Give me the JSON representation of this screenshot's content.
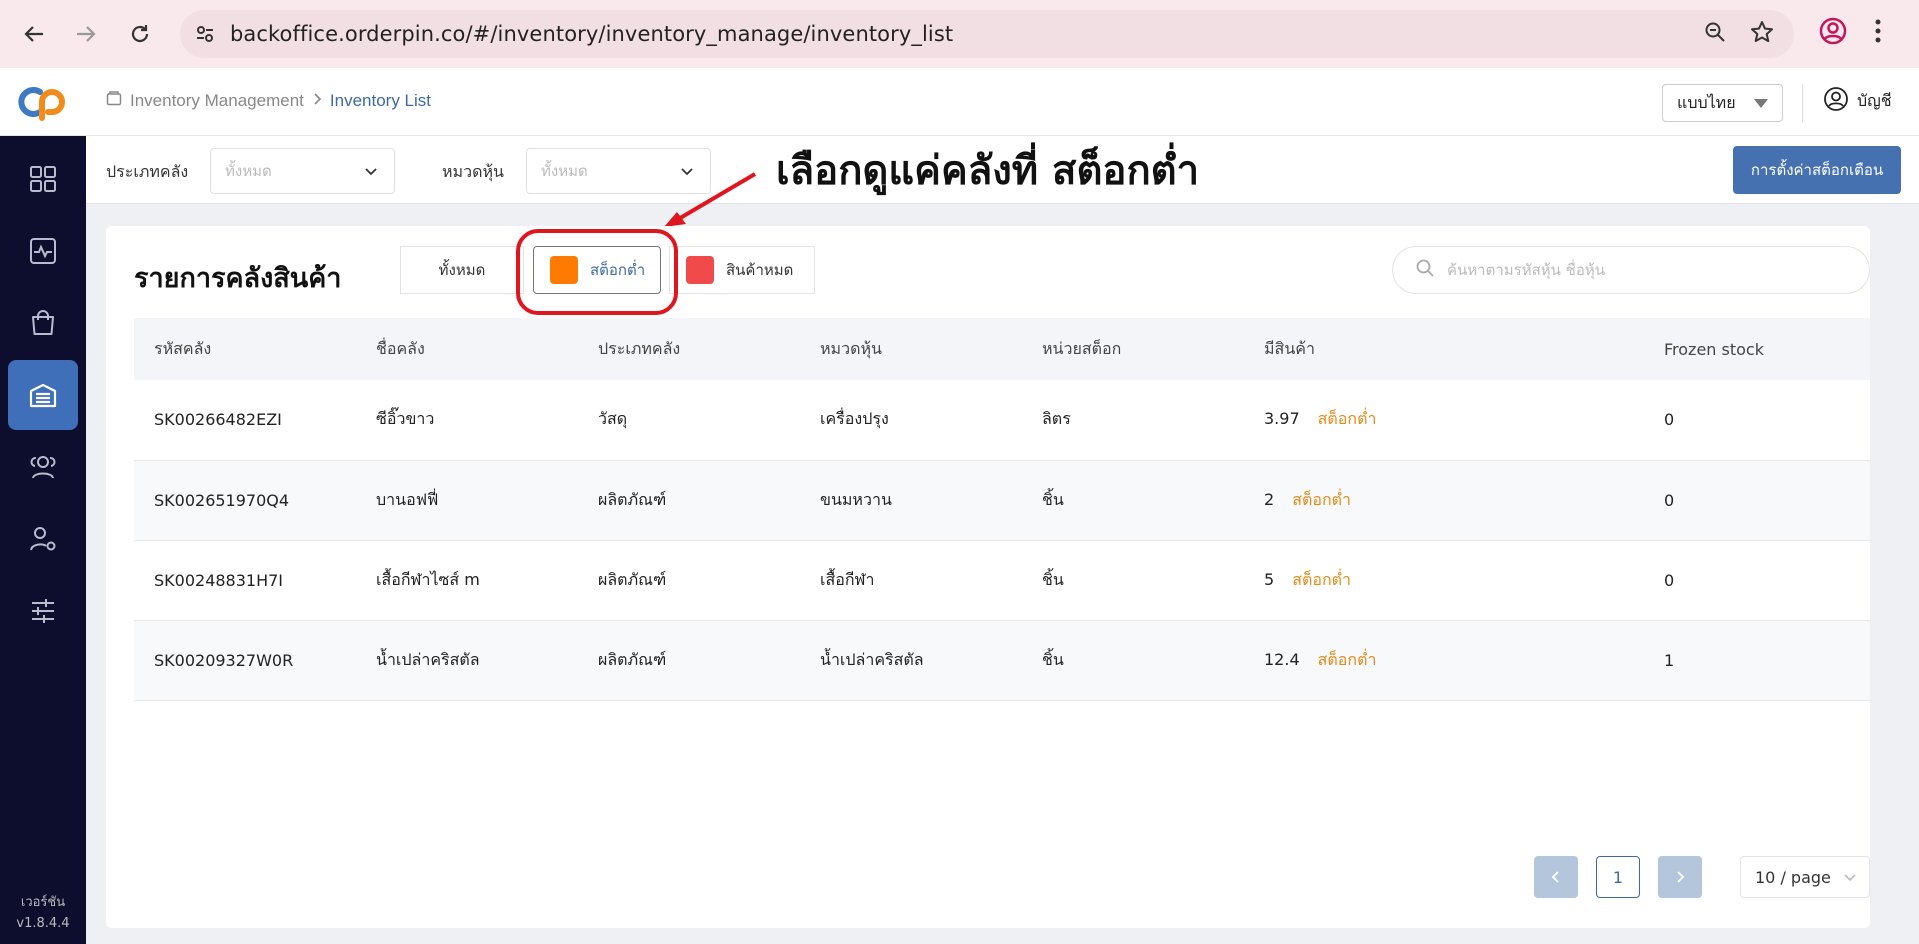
{
  "browser": {
    "url": "backoffice.orderpin.co/#/inventory/inventory_manage/inventory_list"
  },
  "header": {
    "breadcrumb": [
      "Inventory Management",
      "Inventory List"
    ],
    "language": "แบบไทย",
    "account_label": "บัญชี"
  },
  "sidebar": {
    "items": [
      "dashboard",
      "activity",
      "shop",
      "inventory",
      "users",
      "user-settings",
      "adjustments"
    ],
    "active": "inventory",
    "version_label": "เวอร์ชัน",
    "version": "v1.8.4.4"
  },
  "filters": {
    "warehouse_type_label": "ประเภทคลัง",
    "warehouse_type_value": "ทั้งหมด",
    "category_label": "หมวดหุ้น",
    "category_value": "ทั้งหมด",
    "settings_button": "การตั้งค่าสต็อกเตือน"
  },
  "annotation": "เลือกดูแค่คลังที่ สต็อกต่ำ",
  "main": {
    "title": "รายการคลังสินค้า",
    "tabs": [
      {
        "label": "ทั้งหมด",
        "color": ""
      },
      {
        "label": "สต็อกต่ำ",
        "color": "#ff7a00"
      },
      {
        "label": "สินค้าหมด",
        "color": "#f04a4a"
      }
    ],
    "active_tab": "สต็อกต่ำ",
    "search_placeholder": "ค้นหาตามรหัสหุ้น ชื่อหุ้น",
    "columns": [
      "รหัสคลัง",
      "ชื่อคลัง",
      "ประเภทคลัง",
      "หมวดหุ้น",
      "หน่วยสต็อก",
      "มีสินค้า",
      "Frozen stock"
    ],
    "rows": [
      {
        "code": "SK00266482EZI",
        "name": "ซีอิ๊วขาว",
        "type": "วัสดุ",
        "category": "เครื่องปรุง",
        "unit": "ลิตร",
        "qty": "3.97",
        "status": "สต็อกต่ำ",
        "frozen": "0"
      },
      {
        "code": "SK002651970Q4",
        "name": "บานอฟฟี่",
        "type": "ผลิตภัณฑ์",
        "category": "ขนมหวาน",
        "unit": "ชิ้น",
        "qty": "2",
        "status": "สต็อกต่ำ",
        "frozen": "0"
      },
      {
        "code": "SK00248831H7I",
        "name": "เสื้อกีฬาไซส์ m",
        "type": "ผลิตภัณฑ์",
        "category": "เสื้อกีฬา",
        "unit": "ชิ้น",
        "qty": "5",
        "status": "สต็อกต่ำ",
        "frozen": "0"
      },
      {
        "code": "SK00209327W0R",
        "name": "น้ำเปล่าคริสตัล",
        "type": "ผลิตภัณฑ์",
        "category": "น้ำเปล่าคริสตัล",
        "unit": "ชิ้น",
        "qty": "12.4",
        "status": "สต็อกต่ำ",
        "frozen": "1"
      }
    ]
  },
  "pagination": {
    "current_page": "1",
    "page_size": "10 / page"
  },
  "colors": {
    "sidebar_bg": "#0d0d2e",
    "accent": "#4671b1",
    "low_stock": "#e88a1a",
    "highlight": "#e0151e"
  }
}
